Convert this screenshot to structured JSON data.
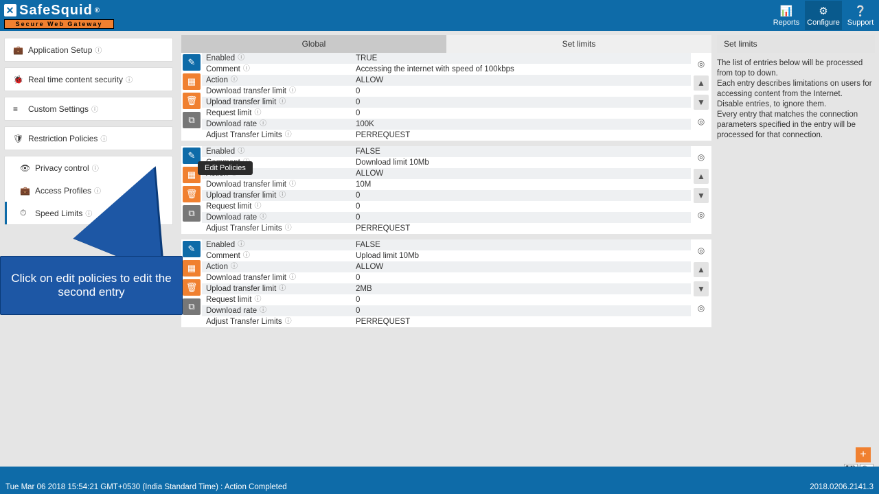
{
  "header": {
    "logo_main": "SafeSquid",
    "logo_reg": "®",
    "logo_sub": "Secure Web Gateway",
    "nav": {
      "reports": "Reports",
      "configure": "Configure",
      "support": "Support"
    }
  },
  "sidebar": {
    "groups": [
      {
        "items": [
          {
            "icon": "briefcase",
            "label": "Application Setup"
          }
        ]
      },
      {
        "items": [
          {
            "icon": "bug",
            "label": "Real time content security"
          }
        ]
      },
      {
        "items": [
          {
            "icon": "sliders",
            "label": "Custom Settings"
          }
        ]
      },
      {
        "items": [
          {
            "icon": "shield",
            "label": "Restriction Policies"
          }
        ]
      },
      {
        "items": [
          {
            "icon": "eye",
            "label": "Privacy control"
          },
          {
            "icon": "briefcase",
            "label": "Access Profiles"
          },
          {
            "icon": "gauge",
            "label": "Speed Limits",
            "active": true
          }
        ]
      }
    ]
  },
  "tabs": {
    "left": "Global",
    "right": "Set limits"
  },
  "tooltip": "Edit Policies",
  "entries": [
    {
      "rows": [
        {
          "lbl": "Enabled",
          "val": "TRUE"
        },
        {
          "lbl": "Comment",
          "val": "Accessing the internet with speed of 100kbps"
        },
        {
          "lbl": "Action",
          "val": "ALLOW"
        },
        {
          "lbl": "Download transfer limit",
          "val": "0"
        },
        {
          "lbl": "Upload transfer limit",
          "val": "0"
        },
        {
          "lbl": "Request limit",
          "val": "0"
        },
        {
          "lbl": "Download rate",
          "val": "100K"
        },
        {
          "lbl": "Adjust Transfer Limits",
          "val": "PERREQUEST"
        }
      ]
    },
    {
      "rows": [
        {
          "lbl": "Enabled",
          "val": "FALSE"
        },
        {
          "lbl": "Comment",
          "val": "Download limit 10Mb"
        },
        {
          "lbl": "Action",
          "val": "ALLOW"
        },
        {
          "lbl": "Download transfer limit",
          "val": "10M"
        },
        {
          "lbl": "Upload transfer limit",
          "val": "0"
        },
        {
          "lbl": "Request limit",
          "val": "0"
        },
        {
          "lbl": "Download rate",
          "val": "0"
        },
        {
          "lbl": "Adjust Transfer Limits",
          "val": "PERREQUEST"
        }
      ]
    },
    {
      "rows": [
        {
          "lbl": "Enabled",
          "val": "FALSE"
        },
        {
          "lbl": "Comment",
          "val": "Upload limit 10Mb"
        },
        {
          "lbl": "Action",
          "val": "ALLOW"
        },
        {
          "lbl": "Download transfer limit",
          "val": "0"
        },
        {
          "lbl": "Upload transfer limit",
          "val": "2MB"
        },
        {
          "lbl": "Request limit",
          "val": "0"
        },
        {
          "lbl": "Download rate",
          "val": "0"
        },
        {
          "lbl": "Adjust Transfer Limits",
          "val": "PERREQUEST"
        }
      ]
    }
  ],
  "right": {
    "title": "Set limits",
    "text": "The list of entries below will be processed from top to down.\nEach entry describes limitations on users for accessing content from the Internet.\nDisable entries, to ignore them.\nEvery entry that matches the connection parameters specified in the entry will be processed for that connection."
  },
  "callout": "Click on edit policies to edit the second entry",
  "footer": {
    "left": "Tue Mar 06 2018 15:54:21 GMT+0530 (India Standard Time) : Action Completed",
    "right": "2018.0206.2141.3"
  }
}
